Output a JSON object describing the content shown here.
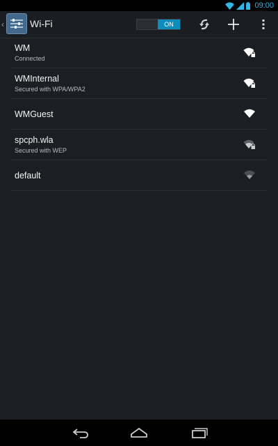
{
  "status_bar": {
    "time": "09:00"
  },
  "action_bar": {
    "title": "Wi-Fi",
    "toggle_label": "ON"
  },
  "networks": [
    {
      "name": "WM",
      "status": "Connected",
      "secured": true,
      "signal": "full",
      "color": "#ffffff"
    },
    {
      "name": "WMInternal",
      "status": "Secured with WPA/WPA2",
      "secured": true,
      "signal": "full",
      "color": "#ffffff"
    },
    {
      "name": "WMGuest",
      "status": "",
      "secured": false,
      "signal": "full",
      "color": "#ffffff"
    },
    {
      "name": "spcph.wla",
      "status": "Secured with WEP",
      "secured": true,
      "signal": "medium",
      "color": "#c9cbcd"
    },
    {
      "name": "default",
      "status": "",
      "secured": false,
      "signal": "low",
      "color": "#9a9da1"
    }
  ],
  "colors": {
    "accent": "#33b5e5",
    "toggle_on": "#0e8dbd"
  },
  "icons": {
    "status": [
      "wifi-icon",
      "signal-icon",
      "battery-icon"
    ],
    "action_bar": [
      "settings-app-icon",
      "refresh-icon",
      "add-icon",
      "overflow-menu-icon"
    ],
    "nav": [
      "back-icon",
      "home-icon",
      "recents-icon"
    ]
  }
}
